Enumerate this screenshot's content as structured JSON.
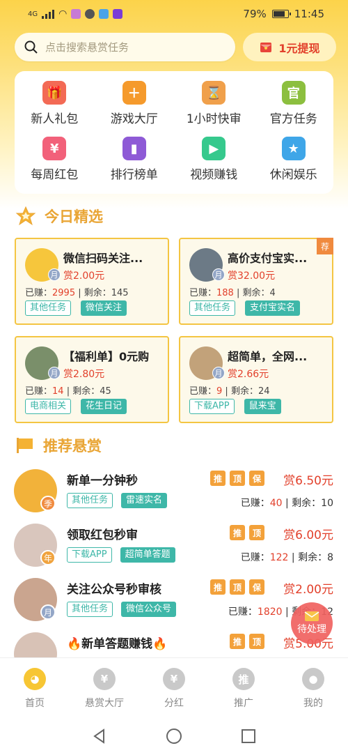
{
  "status_bar": {
    "network": "4G",
    "battery": "79%",
    "time": "11:45"
  },
  "search": {
    "placeholder": "点击搜索悬赏任务"
  },
  "withdraw": {
    "label": "1元提现"
  },
  "categories": [
    {
      "label": "新人礼包",
      "icon": "gift-icon",
      "color": "#f36a55"
    },
    {
      "label": "游戏大厅",
      "icon": "gamepad-icon",
      "color": "#f59a2c"
    },
    {
      "label": "1小时快审",
      "icon": "stamp-icon",
      "color": "#f0a04b"
    },
    {
      "label": "官方任务",
      "icon": "official-icon",
      "color": "#8cbf3f"
    },
    {
      "label": "每周红包",
      "icon": "red-envelope-icon",
      "color": "#f2617a"
    },
    {
      "label": "排行榜单",
      "icon": "podium-icon",
      "color": "#8e5ad6"
    },
    {
      "label": "视频赚钱",
      "icon": "video-icon",
      "color": "#36c98d"
    },
    {
      "label": "休闲娱乐",
      "icon": "star-icon",
      "color": "#3fa6e8"
    }
  ],
  "today_section": {
    "title": "今日精选"
  },
  "featured": [
    {
      "title": "微信扫码关注...",
      "reward": "赏2.00元",
      "earned_label": "已赚：",
      "earned": "2995",
      "remain_label": " | 剩余：",
      "remain": "145",
      "tags": [
        "其他任务",
        "微信关注"
      ],
      "badge": "月"
    },
    {
      "title": "高价支付宝实...",
      "reward": "赏32.00元",
      "earned_label": "已赚：",
      "earned": "188",
      "remain_label": " | 剩余：",
      "remain": "4",
      "tags": [
        "其他任务",
        "支付宝实名"
      ],
      "badge": "月",
      "ribbon": "荐"
    },
    {
      "title": "【福利单】0元购",
      "reward": "赏2.80元",
      "earned_label": "已赚：",
      "earned": "14",
      "remain_label": " | 剩余：",
      "remain": "45",
      "tags": [
        "电商相关",
        "花生日记"
      ],
      "badge": "月"
    },
    {
      "title": "超简单，全网...",
      "reward": "赏2.66元",
      "earned_label": "已赚：",
      "earned": "9",
      "remain_label": " | 剩余：",
      "remain": "24",
      "tags": [
        "下载APP",
        "鼠来宝"
      ],
      "badge": "月"
    }
  ],
  "recommend_section": {
    "title": "推荐悬赏"
  },
  "recommended": [
    {
      "title": "新单一分钟秒",
      "reward": "赏6.50元",
      "flags": [
        "推",
        "顶",
        "保"
      ],
      "tags": [
        "其他任务",
        "雷速实名"
      ],
      "earned_label": "已赚：",
      "earned": "40",
      "remain_label": " | 剩余：",
      "remain": "10",
      "badge": "季",
      "badge_color": "#f08a3e"
    },
    {
      "title": "领取红包秒审",
      "reward": "赏6.00元",
      "flags": [
        "推",
        "顶"
      ],
      "tags": [
        "下载APP",
        "超简单答题"
      ],
      "earned_label": "已赚：",
      "earned": "122",
      "remain_label": " | 剩余：",
      "remain": "8",
      "badge": "年",
      "badge_color": "#f0a33e"
    },
    {
      "title": "关注公众号秒审核",
      "reward": "赏2.00元",
      "flags": [
        "推",
        "顶",
        "保"
      ],
      "tags": [
        "其他任务",
        "微信公众号"
      ],
      "earned_label": "已赚：",
      "earned": "1820",
      "remain_label": " | 剩余：",
      "remain": "12",
      "badge": "月",
      "badge_color": "#93a6c7"
    },
    {
      "title": "🔥新单答题赚钱🔥",
      "reward": "赏5.00元",
      "flags": [
        "推",
        "顶"
      ],
      "tags": [],
      "earned_label": "",
      "earned": "",
      "remain_label": "",
      "remain": "",
      "badge": "",
      "badge_color": "#93a6c7"
    }
  ],
  "pending": {
    "label": "待处理"
  },
  "bottom_nav": [
    {
      "label": "首页",
      "icon": "home-dog-icon",
      "active": true
    },
    {
      "label": "悬赏大厅",
      "icon": "money-bag-icon",
      "active": false
    },
    {
      "label": "分红",
      "icon": "dividend-icon",
      "active": false
    },
    {
      "label": "推广",
      "icon": "promote-icon",
      "active": false
    },
    {
      "label": "我的",
      "icon": "user-icon",
      "active": false
    }
  ]
}
